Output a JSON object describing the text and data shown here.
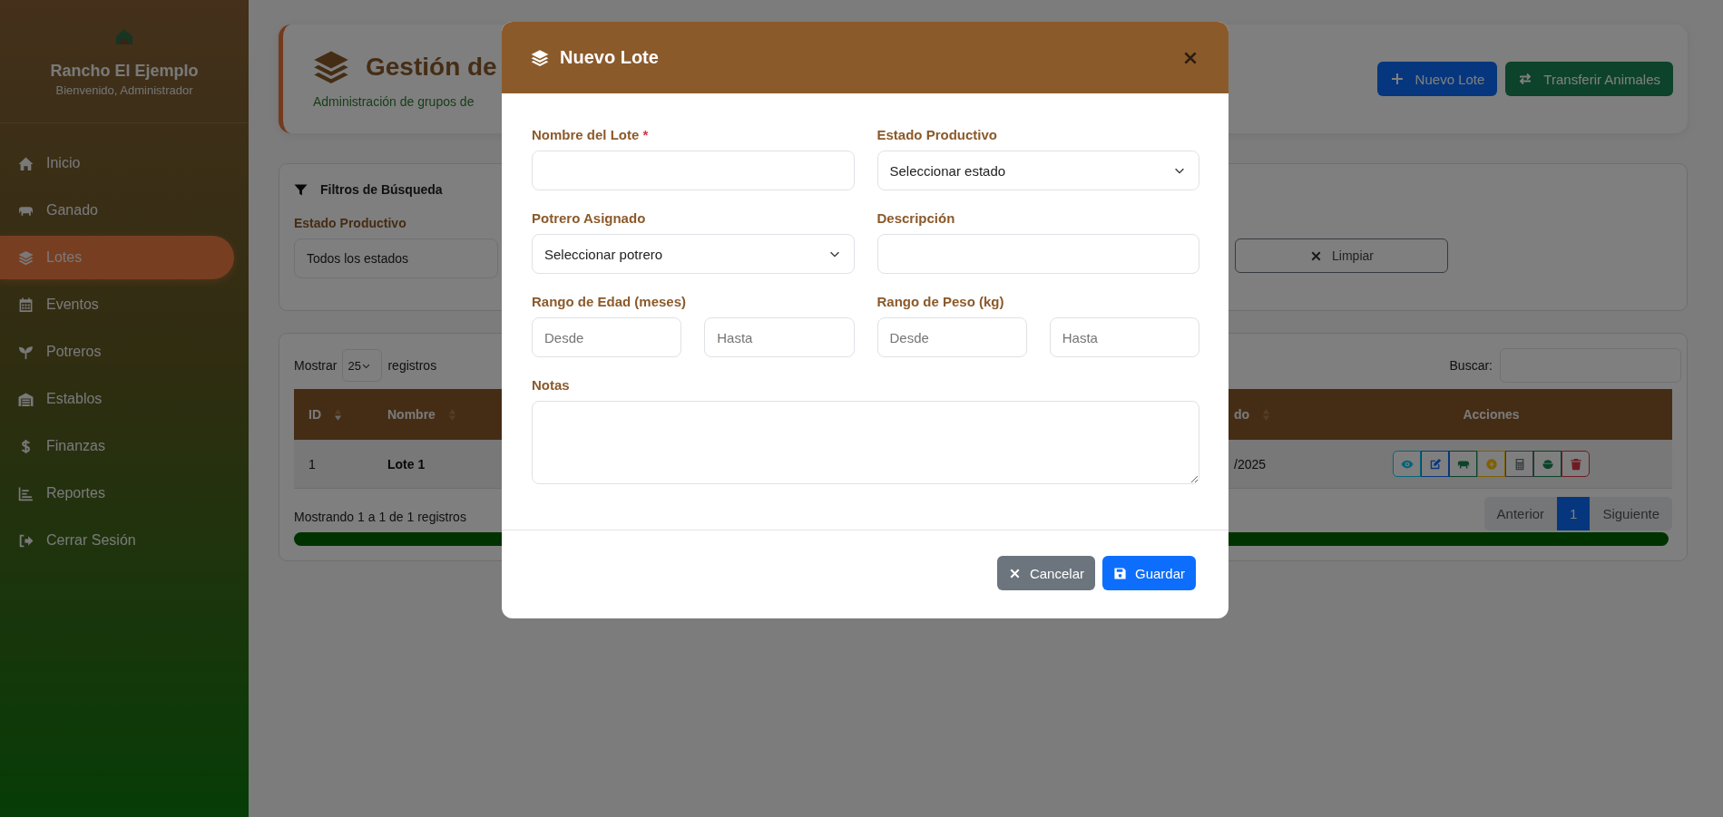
{
  "sidebar": {
    "title": "Rancho El Ejemplo",
    "subtitle": "Bienvenido, Administrador",
    "items": [
      {
        "label": "Inicio",
        "selected": false
      },
      {
        "label": "Ganado",
        "selected": false
      },
      {
        "label": "Lotes",
        "selected": true
      },
      {
        "label": "Eventos",
        "selected": false
      },
      {
        "label": "Potreros",
        "selected": false
      },
      {
        "label": "Establos",
        "selected": false
      },
      {
        "label": "Finanzas",
        "selected": false
      },
      {
        "label": "Reportes",
        "selected": false
      },
      {
        "label": "Cerrar Sesión",
        "selected": false
      }
    ]
  },
  "header": {
    "title": "Gestión de",
    "subtitle": "Administración de grupos de",
    "buttons": [
      {
        "label": "Nuevo Lote",
        "kind": "primary"
      },
      {
        "label": "Transferir Animales",
        "kind": "success"
      }
    ]
  },
  "filters": {
    "title": "Filtros de Búsqueda",
    "label": "Estado Productivo",
    "select_value": "Todos los estados",
    "clear_button": "Limpiar"
  },
  "table": {
    "show_label": "Mostrar",
    "page_size": "25",
    "records_label": "registros",
    "search_label": "Buscar:",
    "columns": [
      {
        "label": "ID",
        "sorted": true
      },
      {
        "label": "Nombre",
        "sorted": false
      },
      {
        "label": "do",
        "sorted": false
      },
      {
        "label": "Acciones"
      }
    ],
    "rows": [
      {
        "cells": [
          "1",
          "Lote 1",
          "/2025"
        ]
      }
    ],
    "info": "Mostrando 1 a 1 de 1 registros",
    "pagination": [
      {
        "label": "Anterior",
        "selected": false
      },
      {
        "label": "1",
        "selected": true
      },
      {
        "label": "Siguiente",
        "selected": false
      }
    ]
  },
  "modal": {
    "title": "Nuevo Lote",
    "fields": [
      {
        "kind": "text",
        "label": "Nombre del Lote",
        "required_mark": "*"
      },
      {
        "kind": "select",
        "label": "Estado Productivo",
        "value": "Seleccionar estado"
      },
      {
        "kind": "select",
        "label": "Potrero Asignado",
        "value": "Seleccionar potrero"
      },
      {
        "kind": "text",
        "label": "Descripción"
      },
      {
        "kind": "range",
        "label": "Rango de Edad (meses)",
        "placeholders": [
          "Desde",
          "Hasta"
        ]
      },
      {
        "kind": "range",
        "label": "Rango de Peso (kg)",
        "placeholders": [
          "Desde",
          "Hasta"
        ]
      },
      {
        "kind": "textarea",
        "label": "Notas"
      }
    ],
    "buttons": [
      {
        "label": "Cancelar",
        "kind": "secondary"
      },
      {
        "label": "Guardar",
        "kind": "primary"
      }
    ]
  }
}
